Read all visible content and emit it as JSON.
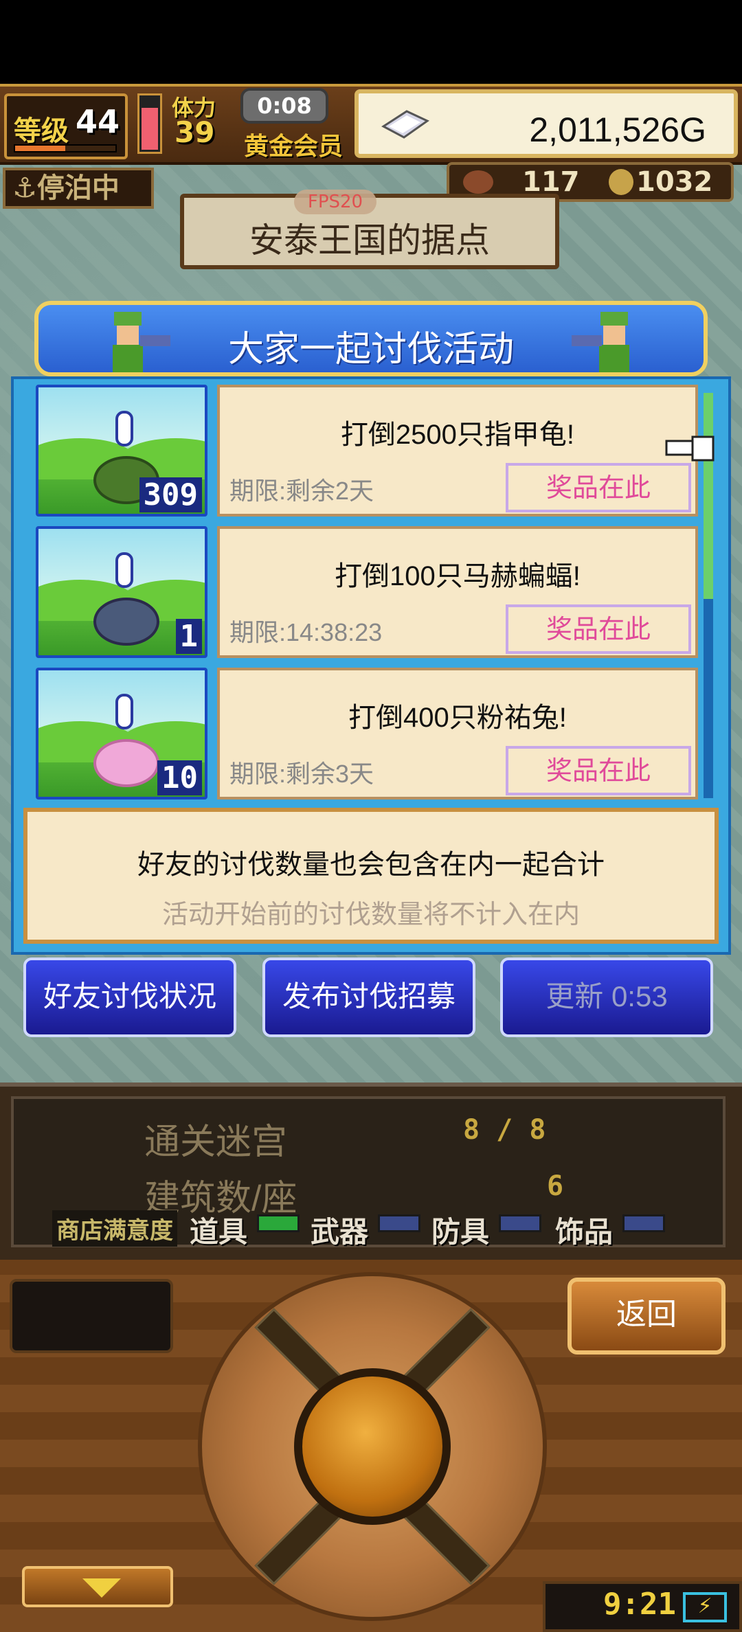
{
  "hud": {
    "level_label": "等级",
    "level": "44",
    "stamina_label": "体力",
    "stamina": "39",
    "timer": "0:08",
    "membership": "黄金会员",
    "money": "2,011,526G",
    "exp_progress": 0.5,
    "stamina_fill": 0.75
  },
  "status": {
    "anchor": "⚓停泊中",
    "resource1": "117",
    "resource2": "1032"
  },
  "location": {
    "name": "安泰王国的据点",
    "fps": "FPS20"
  },
  "dialog": {
    "title": "大家一起讨伐活动",
    "missions": [
      {
        "title": "打倒2500只指甲龟!",
        "deadline": "期限:剩余2天",
        "prize": "奖品在此",
        "count": "309"
      },
      {
        "title": "打倒100只马赫蝙蝠!",
        "deadline": "期限:14:38:23",
        "prize": "奖品在此",
        "count": "1"
      },
      {
        "title": "打倒400只粉祐兔!",
        "deadline": "期限:剩余3天",
        "prize": "奖品在此",
        "count": "10"
      }
    ],
    "info_line1": "好友的讨伐数量也会包含在内一起合计",
    "info_line2": "活动开始前的讨伐数量将不计入在内",
    "buttons": {
      "friends": "好友讨伐状况",
      "recruit": "发布讨伐招募",
      "refresh": "更新 0:53"
    }
  },
  "lower": {
    "dungeon_label": "通关迷宫",
    "dungeon_value": "8 / 8",
    "building_label": "建筑数/座",
    "building_value": "6",
    "shop_label": "商店满意度",
    "categories": [
      "道具",
      "武器",
      "防具",
      "饰品"
    ]
  },
  "controls": {
    "back": "返回",
    "clock": "9:21"
  },
  "colors": {
    "dialog_header": "#2a60d0",
    "prize_text": "#e04a9a",
    "card_bg": "#f7e8c8"
  }
}
